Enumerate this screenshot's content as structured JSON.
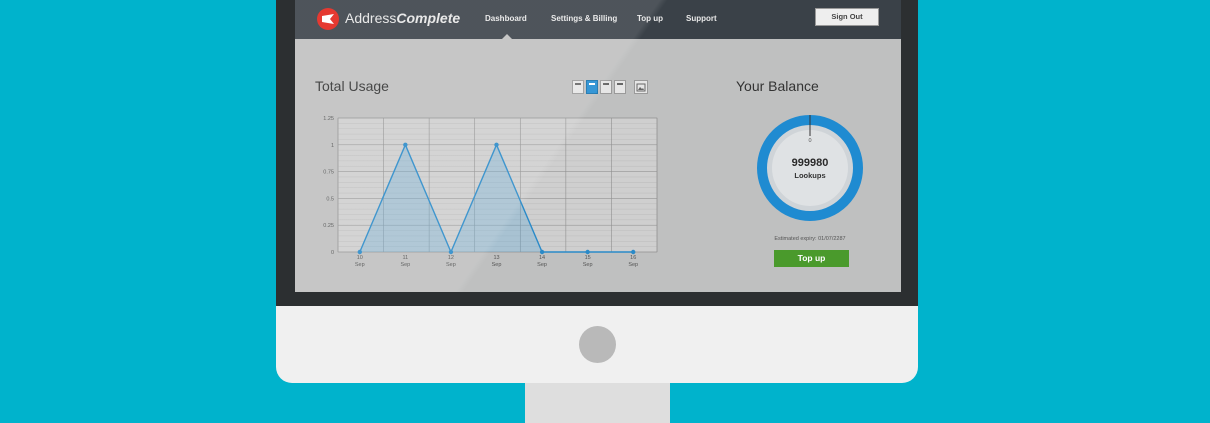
{
  "header": {
    "brand_prefix": "Address",
    "brand_emphasis": "Complete",
    "nav": [
      {
        "label": "Dashboard",
        "active": true
      },
      {
        "label": "Settings & Billing",
        "active": false
      },
      {
        "label": "Top up",
        "active": false
      },
      {
        "label": "Support",
        "active": false
      }
    ],
    "sign_out_label": "Sign Out"
  },
  "usage": {
    "title": "Total Usage",
    "chart_buttons_active_index": 1
  },
  "balance": {
    "title": "Your Balance",
    "gauge_label": "0",
    "value": "999980",
    "unit": "Lookups",
    "expiry": "Estimated expiry: 01/07/2287",
    "topup_label": "Top up"
  },
  "colors": {
    "background": "#00b3cc",
    "header": "#3a4148",
    "accent_blue": "#1f8bd1",
    "topup_green": "#4a9a2c",
    "brand_red": "#e2231a"
  },
  "chart_data": {
    "type": "area",
    "categories": [
      "10 Sep",
      "11 Sep",
      "12 Sep",
      "13 Sep",
      "14 Sep",
      "15 Sep",
      "16 Sep"
    ],
    "series": [
      {
        "values": [
          0,
          1,
          0,
          1,
          0,
          0,
          0
        ]
      }
    ],
    "y_ticks": [
      "0",
      "0.25",
      "0.5",
      "0.75",
      "1",
      "1.25"
    ],
    "ylim": [
      0,
      1.25
    ],
    "title": "",
    "xlabel": "",
    "ylabel": "",
    "grid": true
  }
}
